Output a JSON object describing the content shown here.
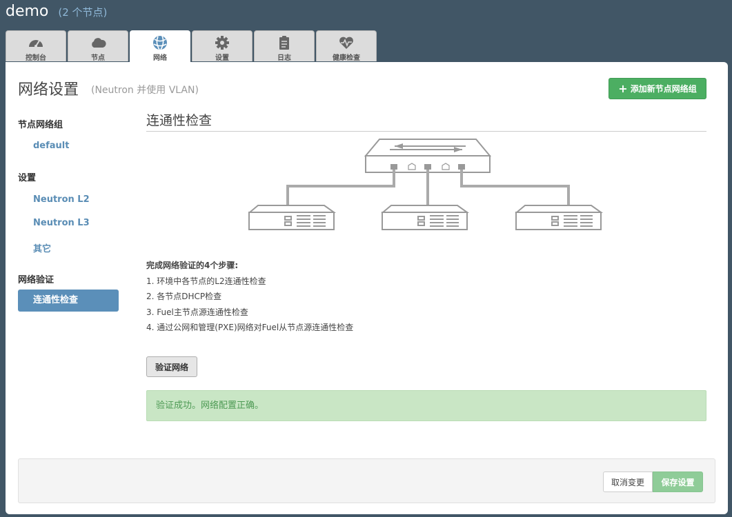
{
  "env": {
    "name": "demo",
    "nodes": "(2 个节点)"
  },
  "tabs": [
    {
      "label": "控制台",
      "icon": "dashboard-icon",
      "active": false
    },
    {
      "label": "节点",
      "icon": "cloud-icon",
      "active": false
    },
    {
      "label": "网络",
      "icon": "network-globe-icon",
      "active": true
    },
    {
      "label": "设置",
      "icon": "gear-icon",
      "active": false
    },
    {
      "label": "日志",
      "icon": "clipboard-icon",
      "active": false
    },
    {
      "label": "健康检查",
      "icon": "heart-pulse-icon",
      "active": false
    }
  ],
  "page": {
    "title": "网络设置",
    "subtitle": "(Neutron 并使用 VLAN)",
    "add_button": "添加新节点网络组"
  },
  "sidebar": {
    "groups": [
      {
        "heading": "节点网络组",
        "items": [
          {
            "label": "default",
            "active": false
          }
        ]
      },
      {
        "heading": "设置",
        "items": [
          {
            "label": "Neutron L2",
            "active": false
          },
          {
            "label": "Neutron L3",
            "active": false
          },
          {
            "label": "其它",
            "active": false
          }
        ]
      },
      {
        "heading": "网络验证",
        "items": [
          {
            "label": "连通性检查",
            "active": true
          }
        ]
      }
    ]
  },
  "content": {
    "section_title": "连通性检查",
    "steps_title": "完成网络验证的4个步骤:",
    "steps": [
      "1. 环境中各节点的L2连通性检查",
      "2. 各节点DHCP检查",
      "3. Fuel主节点源连通性检查",
      "4. 通过公网和管理(PXE)网络对Fuel从节点源连通性检查"
    ],
    "verify_button": "验证网络",
    "alert": "验证成功。网络配置正确。"
  },
  "footer": {
    "cancel": "取消变更",
    "save": "保存设置"
  },
  "colors": {
    "background": "#415666",
    "accent_green": "#4cae62",
    "sidebar_active": "#5b8fb9",
    "alert_bg": "#c9e6c5"
  }
}
